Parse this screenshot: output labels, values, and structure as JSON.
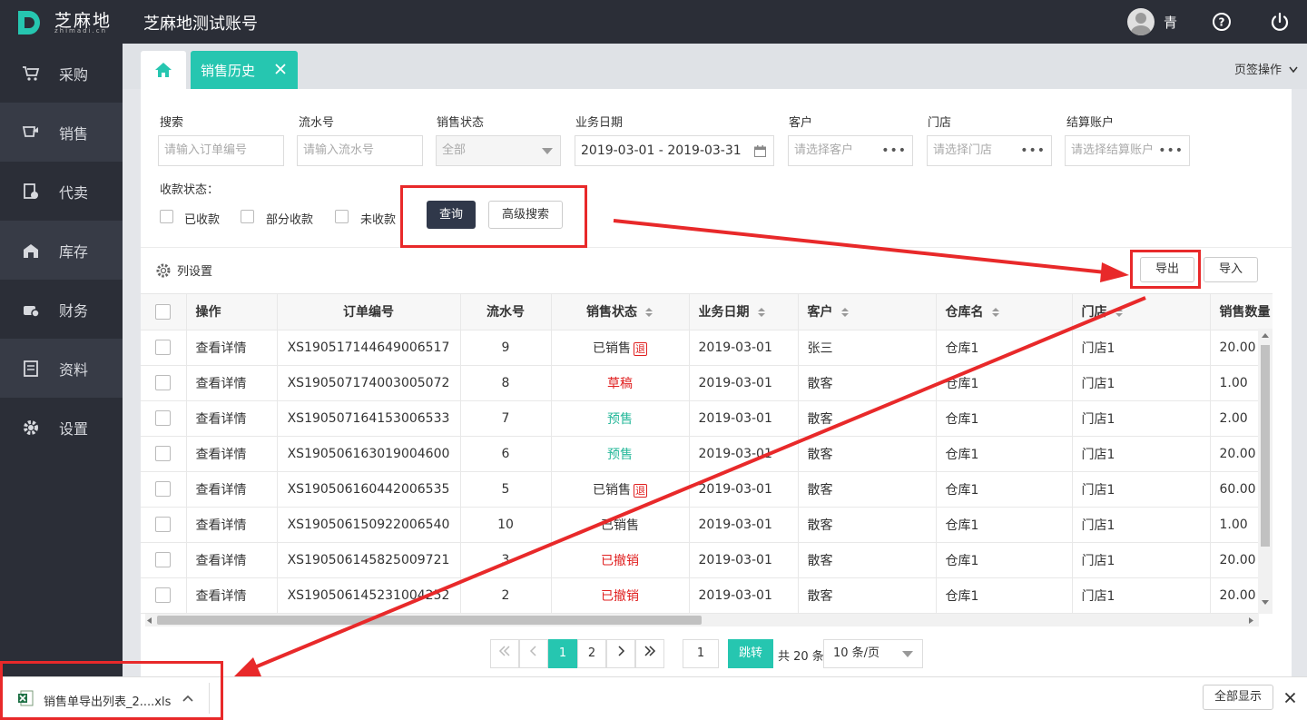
{
  "header": {
    "logo_text": "芝麻地",
    "logo_sub": "zhimadi.cn",
    "app_title": "芝麻地测试账号",
    "user_name": "青"
  },
  "sidebar": {
    "items": [
      {
        "label": "采购",
        "icon": "cart-icon"
      },
      {
        "label": "销售",
        "icon": "sale-icon"
      },
      {
        "label": "代卖",
        "icon": "consign-icon"
      },
      {
        "label": "库存",
        "icon": "warehouse-icon"
      },
      {
        "label": "财务",
        "icon": "finance-icon"
      },
      {
        "label": "资料",
        "icon": "data-icon"
      },
      {
        "label": "设置",
        "icon": "gear-icon"
      }
    ]
  },
  "tabs": {
    "active_label": "销售历史",
    "ops_label": "页签操作"
  },
  "filters": {
    "search_label": "搜索",
    "search_placeholder": "请输入订单编号",
    "serial_label": "流水号",
    "serial_placeholder": "请输入流水号",
    "status_label": "销售状态",
    "status_value": "全部",
    "date_label": "业务日期",
    "date_value": "2019-03-01 - 2019-03-31",
    "customer_label": "客户",
    "customer_placeholder": "请选择客户",
    "store_label": "门店",
    "store_placeholder": "请选择门店",
    "account_label": "结算账户",
    "account_placeholder": "请选择结算账户",
    "payment_label": "收款状态：",
    "payment_options": [
      "已收款",
      "部分收款",
      "未收款"
    ],
    "query_button": "查询",
    "advanced_button": "高级搜索"
  },
  "toolbar": {
    "column_settings": "列设置",
    "export_button": "导出",
    "import_button": "导入"
  },
  "table": {
    "headers": [
      "操作",
      "订单编号",
      "流水号",
      "销售状态",
      "业务日期",
      "客户",
      "仓库名",
      "门店",
      "销售数量"
    ],
    "rows": [
      {
        "op": "查看详情",
        "order": "XS190517144649006517",
        "serial": "9",
        "status": "已销售",
        "status_type": "normal",
        "returned": true,
        "date": "2019-03-01",
        "customer": "张三",
        "warehouse": "仓库1",
        "store": "门店1",
        "qty": "20.00"
      },
      {
        "op": "查看详情",
        "order": "XS190507174003005072",
        "serial": "8",
        "status": "草稿",
        "status_type": "red",
        "returned": false,
        "date": "2019-03-01",
        "customer": "散客",
        "warehouse": "仓库1",
        "store": "门店1",
        "qty": "1.00"
      },
      {
        "op": "查看详情",
        "order": "XS190507164153006533",
        "serial": "7",
        "status": "预售",
        "status_type": "green",
        "returned": false,
        "date": "2019-03-01",
        "customer": "散客",
        "warehouse": "仓库1",
        "store": "门店1",
        "qty": "2.00"
      },
      {
        "op": "查看详情",
        "order": "XS190506163019004600",
        "serial": "6",
        "status": "预售",
        "status_type": "green",
        "returned": false,
        "date": "2019-03-01",
        "customer": "散客",
        "warehouse": "仓库1",
        "store": "门店1",
        "qty": "20.00"
      },
      {
        "op": "查看详情",
        "order": "XS190506160442006535",
        "serial": "5",
        "status": "已销售",
        "status_type": "normal",
        "returned": true,
        "date": "2019-03-01",
        "customer": "散客",
        "warehouse": "仓库1",
        "store": "门店1",
        "qty": "60.00"
      },
      {
        "op": "查看详情",
        "order": "XS190506150922006540",
        "serial": "10",
        "status": "已销售",
        "status_type": "normal",
        "returned": false,
        "date": "2019-03-01",
        "customer": "散客",
        "warehouse": "仓库1",
        "store": "门店1",
        "qty": "1.00"
      },
      {
        "op": "查看详情",
        "order": "XS190506145825009721",
        "serial": "3",
        "status": "已撤销",
        "status_type": "red",
        "returned": false,
        "date": "2019-03-01",
        "customer": "散客",
        "warehouse": "仓库1",
        "store": "门店1",
        "qty": "20.00"
      },
      {
        "op": "查看详情",
        "order": "XS190506145231004252",
        "serial": "2",
        "status": "已撤销",
        "status_type": "red",
        "returned": false,
        "date": "2019-03-01",
        "customer": "散客",
        "warehouse": "仓库1",
        "store": "门店1",
        "qty": "20.00"
      }
    ],
    "return_badge": "退"
  },
  "pagination": {
    "pages": [
      "1",
      "2"
    ],
    "current": "1",
    "jump_value": "1",
    "jump_button": "跳转",
    "total_text": "共 20 条",
    "page_size": "10 条/页"
  },
  "download_bar": {
    "file_name": "销售单导出列表_2....xls",
    "show_all": "全部显示"
  },
  "colors": {
    "accent": "#26c6b0",
    "dark": "#2b2e37",
    "annotation": "#e8292a"
  }
}
